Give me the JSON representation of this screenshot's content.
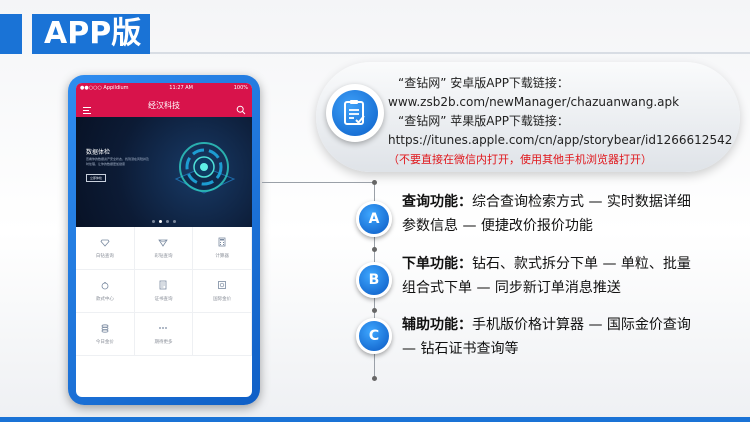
{
  "page": {
    "title": "APP版"
  },
  "phone": {
    "status": {
      "carrier": "●●○○○ Appildium",
      "time": "11:27 AM",
      "battery": "100%"
    },
    "nav_title": "经汉科技",
    "banner": {
      "title": "数据体检",
      "desc": "查看你的数据资产安全状态，找到潜在风险并及时处理，让你的数据更加健康",
      "button": "立即体检"
    },
    "grid": [
      {
        "label": "白钻查询",
        "icon": "diamond-outline-icon"
      },
      {
        "label": "彩钻查询",
        "icon": "diamond-heart-icon"
      },
      {
        "label": "计算器",
        "icon": "calculator-icon"
      },
      {
        "label": "款式中心",
        "icon": "ring-icon"
      },
      {
        "label": "证书查询",
        "icon": "certificate-icon"
      },
      {
        "label": "国际金价",
        "icon": "gold-price-icon"
      },
      {
        "label": "今日金价",
        "icon": "coins-icon"
      },
      {
        "label": "期待更多",
        "icon": "more-dots-icon"
      }
    ]
  },
  "callout": {
    "line1": "“查钻网” 安卓版APP下载链接：",
    "line2": "www.zsb2b.com/newManager/chazuanwang.apk",
    "line3": "“查钻网” 苹果版APP下载链接：",
    "line4": "https://itunes.apple.com/cn/app/storybear/id1266612542",
    "warning": "（不要直接在微信内打开，使用其他手机浏览器打开）"
  },
  "features": [
    {
      "badge": "A",
      "title": "查询功能：",
      "text": "综合查询检索方式 — 实时数据详细参数信息 — 便捷改价报价功能"
    },
    {
      "badge": "B",
      "title": "下单功能：",
      "text": "钻石、款式拆分下单 — 单粒、批量组合式下单 — 同步新订单消息推送"
    },
    {
      "badge": "C",
      "title": "辅助功能：",
      "text": "手机版价格计算器 — 国际金价查询 — 钻石证书查询等"
    }
  ],
  "colors": {
    "accent": "#1a73d6",
    "app_red": "#d8134b",
    "warning": "#e0161b"
  }
}
